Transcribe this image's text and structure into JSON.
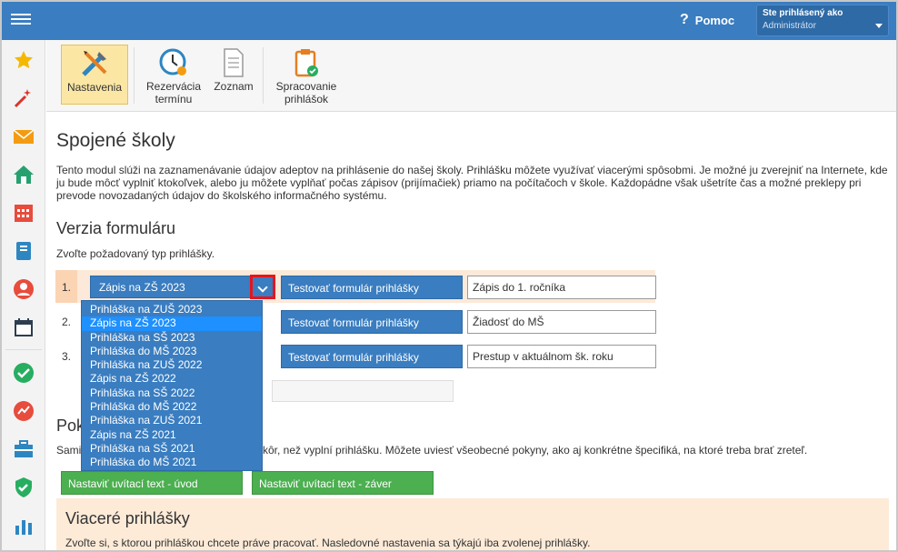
{
  "header": {
    "help_icon": "?",
    "help_label": "Pomoc",
    "user_line1": "Ste prihlásený ako",
    "user_line2": "Administrátor"
  },
  "sidebar": {
    "icons": [
      "star-icon",
      "magic-wand-icon",
      "envelope-icon",
      "home-icon",
      "calendar-grid-icon",
      "notebook-icon",
      "user-icon",
      "calendar-icon",
      "check-circle-icon",
      "chart-circle-icon",
      "briefcase-icon",
      "shield-check-icon",
      "bar-chart-icon"
    ]
  },
  "ribbon": {
    "nastavenia": "Nastavenia",
    "rezervacia_line1": "Rezervácia",
    "rezervacia_line2": "termínu",
    "zoznam": "Zoznam",
    "spracovanie_line1": "Spracovanie",
    "spracovanie_line2": "prihlášok"
  },
  "main": {
    "title": "Spojené školy",
    "intro": "Tento modul slúži na zaznamenávanie údajov adeptov na prihlásenie do našej školy. Prihlášku môžete využívať viacerými spôsobmi. Je možné ju zverejniť na Internete, kde ju bude môcť vyplniť ktokoľvek, alebo ju môžete vyplňať počas zápisov (prijímačiek) priamo na počítačoch v škole. Každopádne však ušetríte čas a možné preklepy pri prevode novozadaných údajov do školského informačného systému.",
    "section_version": "Verzia formuláru",
    "version_hint": "Zvoľte požadovaný typ prihlášky.",
    "rows": [
      {
        "num": "1.",
        "select": "Zápis na ZŠ 2023",
        "button": "Testovať formulár prihlášky",
        "value": "Zápis do 1. ročníka"
      },
      {
        "num": "2.",
        "select": "",
        "button": "Testovať formulár prihlášky",
        "value": "Žiadosť do MŠ"
      },
      {
        "num": "3.",
        "select": "",
        "button": "Testovať formulár prihlášky",
        "value": "Prestup v aktuálnom šk. roku"
      }
    ],
    "dropdown_options": [
      "Prihláška na ZUŠ 2023",
      "Zápis na ZŠ 2023",
      "Prihláška na SŠ 2023",
      "Prihláška do MŠ 2023",
      "Prihláška na ZUŠ 2022",
      "Zápis na ZŠ 2022",
      "Prihláška na SŠ 2022",
      "Prihláška do MŠ 2022",
      "Prihláška na ZUŠ 2021",
      "Zápis na ZŠ 2021",
      "Prihláška na SŠ 2021",
      "Prihláška do MŠ 2021"
    ],
    "section_instructions_visible": "Pok",
    "instructions_left": "Sami",
    "instructions_right": "kôr, než vyplní prihlášku. Môžete uviesť všeobecné pokyny, ako aj konkrétne špecifiká, na ktoré treba brať zreteľ.",
    "btn_intro": "Nastaviť uvítací text - úvod",
    "btn_outro": "Nastaviť uvítací text - záver",
    "panel_title": "Viaceré prihlášky",
    "panel_text": "Zvoľte si, s ktorou prihláškou chcete práve pracovať. Nasledovné nastavenia sa týkajú iba zvolenej prihlášky."
  },
  "colors": {
    "topbar": "#3a7dc0",
    "accent_red": "#e8141c",
    "green": "#4caf50",
    "highlight": "#fde9d9"
  }
}
